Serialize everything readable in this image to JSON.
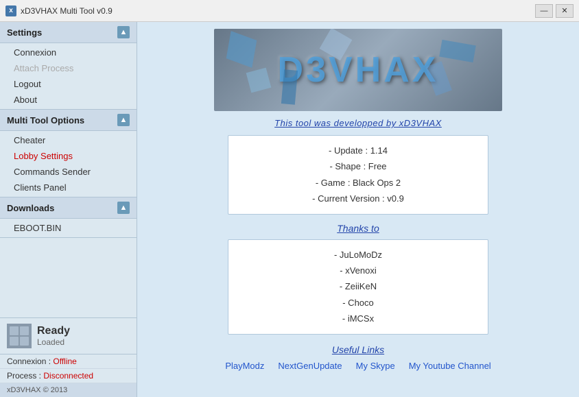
{
  "titlebar": {
    "icon_label": "x",
    "title": "xD3VHAX Multi Tool v0.9",
    "minimize_label": "—",
    "close_label": "✕"
  },
  "sidebar": {
    "settings_section": {
      "title": "Settings",
      "items": [
        {
          "label": "Connexion",
          "state": "normal"
        },
        {
          "label": "Attach Process",
          "state": "disabled"
        },
        {
          "label": "Logout",
          "state": "normal"
        },
        {
          "label": "About",
          "state": "normal"
        }
      ]
    },
    "multitool_section": {
      "title": "Multi Tool Options",
      "items": [
        {
          "label": "Cheater",
          "state": "normal"
        },
        {
          "label": "Lobby Settings",
          "state": "highlight"
        },
        {
          "label": "Commands Sender",
          "state": "normal"
        },
        {
          "label": "Clients Panel",
          "state": "normal"
        }
      ]
    },
    "downloads_section": {
      "title": "Downloads",
      "items": [
        {
          "label": "EBOOT.BIN",
          "state": "normal"
        }
      ]
    },
    "status": {
      "ready_label": "Ready",
      "loaded_label": "Loaded",
      "connexion_label": "Connexion :",
      "connexion_value": "Offline",
      "process_label": "Process :",
      "process_value": "Disconnected",
      "copyright": "xD3VHAX © 2013"
    }
  },
  "content": {
    "dev_text": "This tool was developped by xD3VHAX",
    "info_lines": [
      "- Update : 1.14",
      "- Shape : Free",
      "- Game : Black Ops 2",
      "- Current Version : v0.9"
    ],
    "thanks_title": "Thanks to",
    "thanks_names": [
      "- JuLoMoDz",
      "- xVenoxi",
      "- ZeiiKeN",
      "- Choco",
      "- iMCSx"
    ],
    "useful_links_title": "Useful Links",
    "links": [
      {
        "label": "PlayModz",
        "url": "#"
      },
      {
        "label": "NextGenUpdate",
        "url": "#"
      },
      {
        "label": "My Skype",
        "url": "#"
      },
      {
        "label": "My Youtube Channel",
        "url": "#"
      }
    ]
  }
}
